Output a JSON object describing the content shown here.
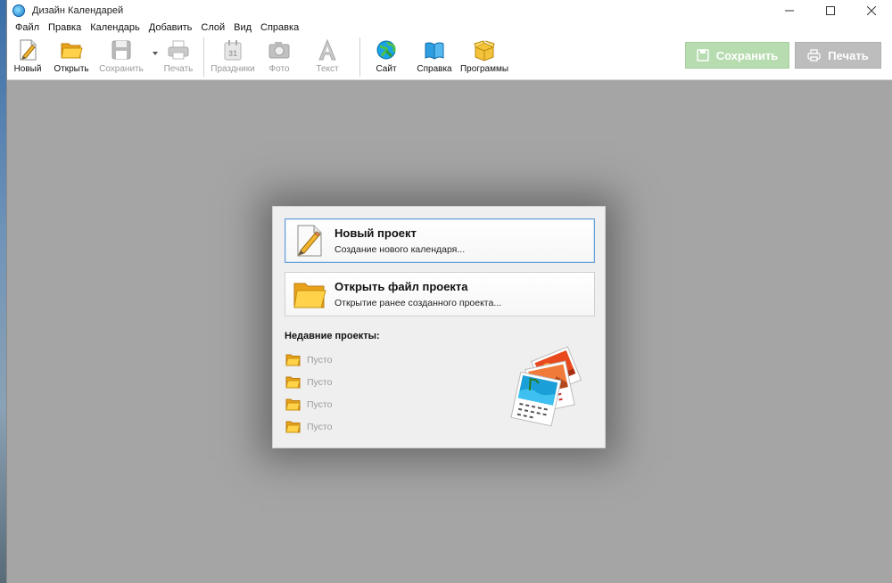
{
  "window": {
    "title": "Дизайн Календарей"
  },
  "menu": [
    "Файл",
    "Правка",
    "Календарь",
    "Добавить",
    "Слой",
    "Вид",
    "Справка"
  ],
  "toolbar": {
    "new": "Новый",
    "open": "Открыть",
    "save": "Сохранить",
    "print": "Печать",
    "holidays": "Праздники",
    "holidays_date": "31",
    "photo": "Фото",
    "text": "Текст",
    "site": "Сайт",
    "help": "Справка",
    "programs": "Программы",
    "save_big": "Сохранить",
    "print_big": "Печать"
  },
  "dialog": {
    "new_project": {
      "title": "Новый проект",
      "subtitle": "Создание нового календаря..."
    },
    "open_project": {
      "title": "Открыть файл проекта",
      "subtitle": "Открытие ранее созданного проекта..."
    },
    "recent_title": "Недавние проекты:",
    "recent": [
      "Пусто",
      "Пусто",
      "Пусто",
      "Пусто"
    ]
  },
  "colors": {
    "accent_border": "#6aa1d6",
    "save_button": "#b6dcb0",
    "print_button": "#bdbdbd",
    "workspace": "#a5a5a5"
  }
}
